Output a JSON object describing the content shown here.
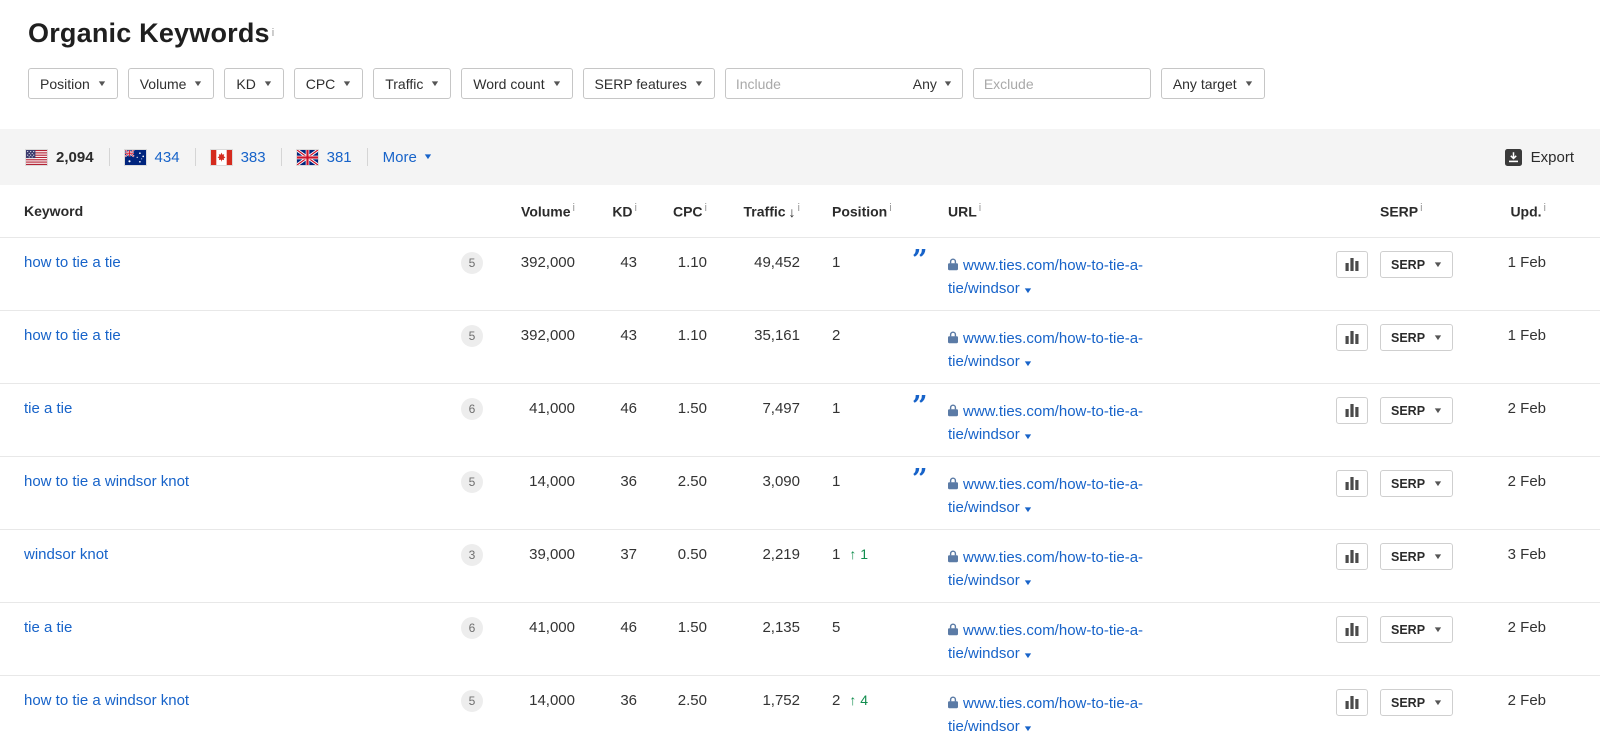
{
  "page": {
    "title": "Organic Keywords"
  },
  "icons": {
    "info": "i",
    "caret_down": "▼",
    "arrow_up": "↑",
    "sort_desc": "↓",
    "quote": "”"
  },
  "filters": {
    "dropdowns": [
      {
        "label": "Position"
      },
      {
        "label": "Volume"
      },
      {
        "label": "KD"
      },
      {
        "label": "CPC"
      },
      {
        "label": "Traffic"
      },
      {
        "label": "Word count"
      },
      {
        "label": "SERP features"
      }
    ],
    "include_placeholder": "Include",
    "include_mode": "Any",
    "exclude_placeholder": "Exclude",
    "target_label": "Any target"
  },
  "countries": [
    {
      "code": "us",
      "count": "2,094"
    },
    {
      "code": "au",
      "count": "434"
    },
    {
      "code": "ca",
      "count": "383"
    },
    {
      "code": "gb",
      "count": "381"
    }
  ],
  "more_label": "More",
  "export_label": "Export",
  "table": {
    "headers": {
      "keyword": "Keyword",
      "volume": "Volume",
      "kd": "KD",
      "cpc": "CPC",
      "traffic": "Traffic",
      "position": "Position",
      "url": "URL",
      "serp": "SERP",
      "updated": "Upd."
    },
    "rows": [
      {
        "keyword": "how to tie a tie",
        "badge": "5",
        "volume": "392,000",
        "kd": "43",
        "cpc": "1.10",
        "traffic": "49,452",
        "position": "1",
        "position_change": "",
        "has_quote": true,
        "url_line1": "www.ties.com/how-to-tie-a-",
        "url_line2": "tie/windsor",
        "serp_label": "SERP",
        "updated": "1 Feb"
      },
      {
        "keyword": "how to tie a tie",
        "badge": "5",
        "volume": "392,000",
        "kd": "43",
        "cpc": "1.10",
        "traffic": "35,161",
        "position": "2",
        "position_change": "",
        "has_quote": false,
        "url_line1": "www.ties.com/how-to-tie-a-",
        "url_line2": "tie/windsor",
        "serp_label": "SERP",
        "updated": "1 Feb"
      },
      {
        "keyword": "tie a tie",
        "badge": "6",
        "volume": "41,000",
        "kd": "46",
        "cpc": "1.50",
        "traffic": "7,497",
        "position": "1",
        "position_change": "",
        "has_quote": true,
        "url_line1": "www.ties.com/how-to-tie-a-",
        "url_line2": "tie/windsor",
        "serp_label": "SERP",
        "updated": "2 Feb"
      },
      {
        "keyword": "how to tie a windsor knot",
        "badge": "5",
        "volume": "14,000",
        "kd": "36",
        "cpc": "2.50",
        "traffic": "3,090",
        "position": "1",
        "position_change": "",
        "has_quote": true,
        "url_line1": "www.ties.com/how-to-tie-a-",
        "url_line2": "tie/windsor",
        "serp_label": "SERP",
        "updated": "2 Feb"
      },
      {
        "keyword": "windsor knot",
        "badge": "3",
        "volume": "39,000",
        "kd": "37",
        "cpc": "0.50",
        "traffic": "2,219",
        "position": "1",
        "position_change": "1",
        "has_quote": false,
        "url_line1": "www.ties.com/how-to-tie-a-",
        "url_line2": "tie/windsor",
        "serp_label": "SERP",
        "updated": "3 Feb"
      },
      {
        "keyword": "tie a tie",
        "badge": "6",
        "volume": "41,000",
        "kd": "46",
        "cpc": "1.50",
        "traffic": "2,135",
        "position": "5",
        "position_change": "",
        "has_quote": false,
        "url_line1": "www.ties.com/how-to-tie-a-",
        "url_line2": "tie/windsor",
        "serp_label": "SERP",
        "updated": "2 Feb"
      },
      {
        "keyword": "how to tie a windsor knot",
        "badge": "5",
        "volume": "14,000",
        "kd": "36",
        "cpc": "2.50",
        "traffic": "1,752",
        "position": "2",
        "position_change": "4",
        "has_quote": false,
        "url_line1": "www.ties.com/how-to-tie-a-",
        "url_line2": "tie/windsor",
        "serp_label": "SERP",
        "updated": "2 Feb"
      }
    ]
  },
  "colors": {
    "link_blue": "#1763c9",
    "green_up": "#118d4e",
    "band_bg": "#f4f4f4"
  }
}
